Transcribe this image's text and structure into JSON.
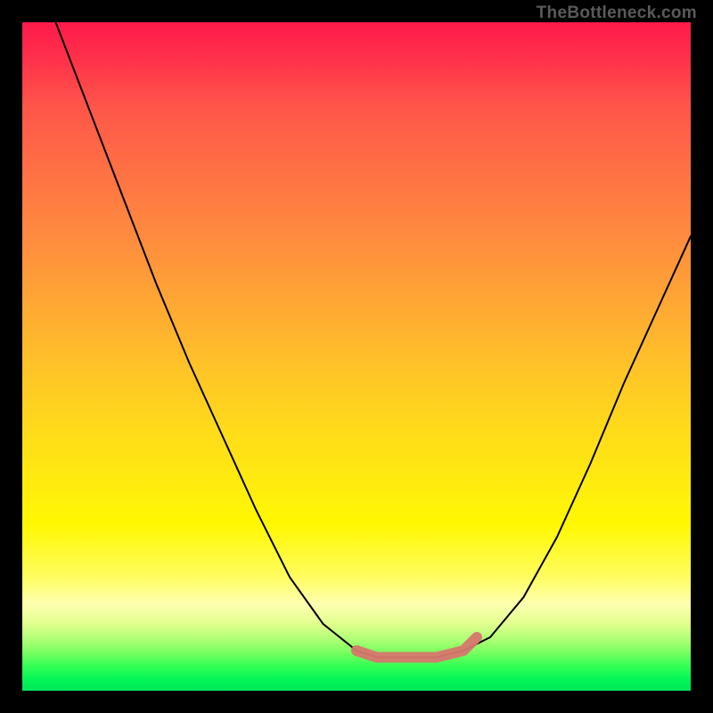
{
  "watermark": "TheBottleneck.com",
  "chart_data": {
    "type": "line",
    "title": "",
    "xlabel": "",
    "ylabel": "",
    "xlim": [
      0,
      100
    ],
    "ylim": [
      0,
      100
    ],
    "grid": false,
    "background": {
      "gradient_direction": "vertical",
      "stops": [
        {
          "pos": 0,
          "color": "#ff1a4b"
        },
        {
          "pos": 50,
          "color": "#ffc427"
        },
        {
          "pos": 75,
          "color": "#fff700"
        },
        {
          "pos": 100,
          "color": "#00e659"
        }
      ],
      "meaning": "red (bottleneck) to green (ideal match)"
    },
    "series": [
      {
        "name": "main-v-curve",
        "color": "#000000",
        "x": [
          5,
          10,
          15,
          20,
          25,
          30,
          35,
          40,
          45,
          50,
          53,
          55,
          58,
          62,
          66,
          70,
          75,
          80,
          85,
          90,
          95,
          100
        ],
        "values": [
          100,
          87,
          74,
          61,
          49,
          38,
          27,
          17,
          10,
          6,
          5,
          5,
          5,
          5,
          6,
          8,
          14,
          23,
          34,
          46,
          57,
          68
        ]
      }
    ],
    "highlight": {
      "name": "optimal-zone",
      "color": "#d7776d",
      "x": [
        50,
        53,
        55,
        58,
        62,
        66,
        68
      ],
      "values": [
        6,
        5,
        5,
        5,
        5,
        6,
        8
      ],
      "note": "thicker salmon stroke over bottom of V"
    }
  }
}
